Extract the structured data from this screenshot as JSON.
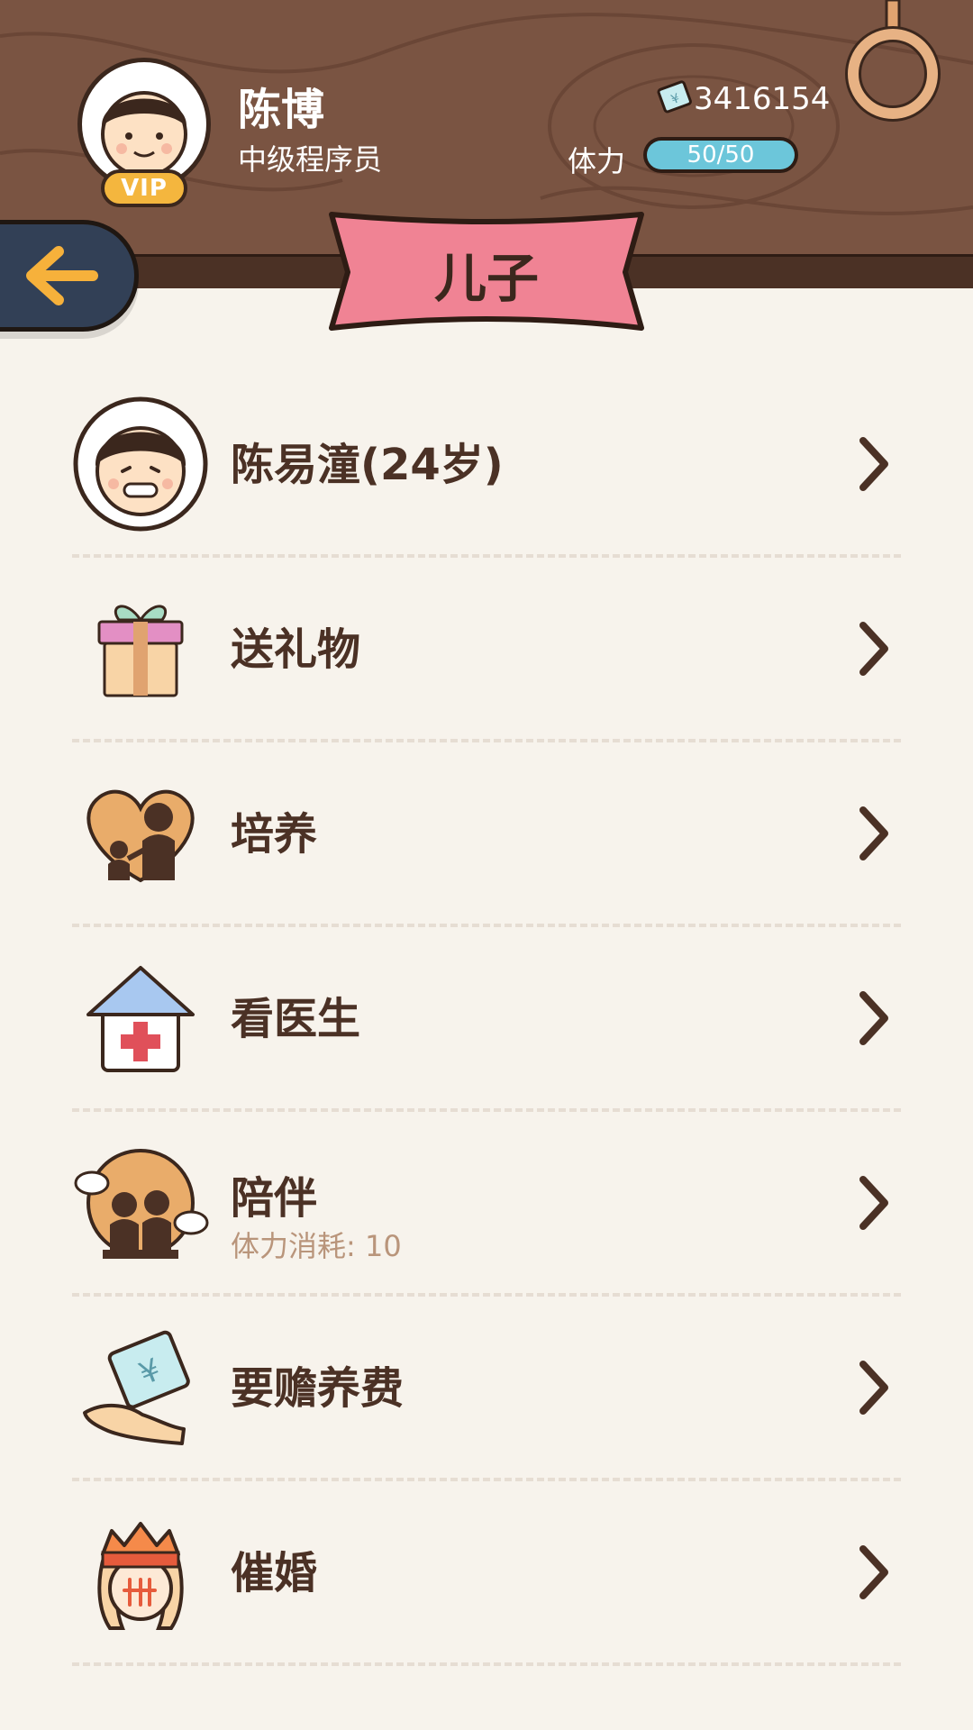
{
  "header": {
    "user_name": "陈博",
    "user_title": "中级程序员",
    "vip_label": "VIP",
    "money": "3416154",
    "stamina_label": "体力",
    "stamina": {
      "text": "50/50",
      "current": 50,
      "max": 50
    },
    "back_icon": "arrow-left-icon",
    "ring_icon": "ring-icon"
  },
  "page": {
    "title": "儿子"
  },
  "menu": {
    "items": [
      {
        "label": "陈易潼(24岁)",
        "icon": "child-avatar"
      },
      {
        "label": "送礼物",
        "icon": "gift-icon"
      },
      {
        "label": "培养",
        "icon": "nurture-icon"
      },
      {
        "label": "看医生",
        "icon": "hospital-icon"
      },
      {
        "label": "陪伴",
        "sub": "体力消耗: 10",
        "icon": "companion-icon"
      },
      {
        "label": "要赡养费",
        "icon": "money-hand-icon"
      },
      {
        "label": "催婚",
        "icon": "urge-marriage-icon"
      }
    ]
  },
  "colors": {
    "wood": "#7a5442",
    "rail": "#4b3125",
    "background": "#f7f3ec",
    "banner": "#f08394",
    "stamina": "#6cc6da",
    "back_button": "#324056",
    "text_dark": "#4b3125"
  }
}
